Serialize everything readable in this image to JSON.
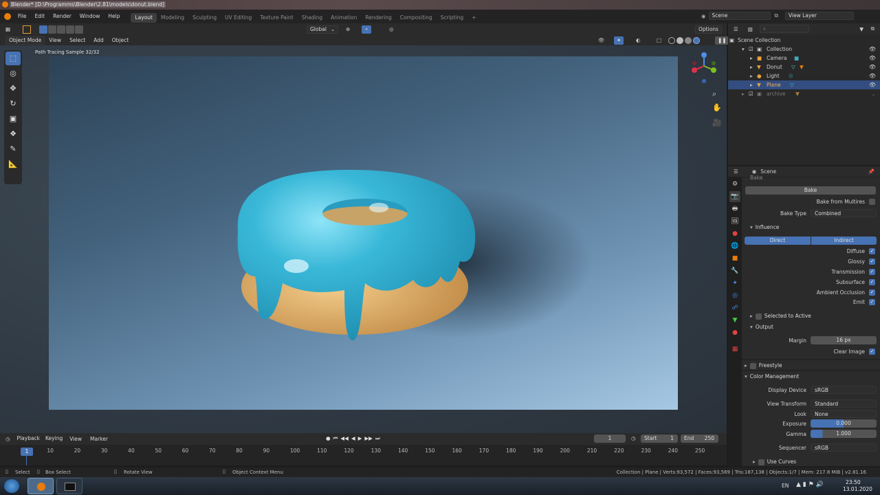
{
  "window": {
    "title": "Blender* [D:\\Programms\\Blender\\2.81\\models\\donut.blend]"
  },
  "menu": {
    "items": [
      "File",
      "Edit",
      "Render",
      "Window",
      "Help"
    ]
  },
  "workspaces": [
    "Layout",
    "Modeling",
    "Sculpting",
    "UV Editing",
    "Texture Paint",
    "Shading",
    "Animation",
    "Rendering",
    "Compositing",
    "Scripting"
  ],
  "active_workspace": "Layout",
  "scene_field": "Scene",
  "view_layer_field": "View Layer",
  "viewport_header": {
    "transform_orientation": "Global",
    "options_label": "Options",
    "mode": "Object Mode",
    "menus": [
      "View",
      "Select",
      "Add",
      "Object"
    ]
  },
  "viewport": {
    "info_text": "Path Tracing Sample 32/32"
  },
  "timeline": {
    "menus": [
      "Playback",
      "Keying",
      "View",
      "Marker"
    ],
    "current_frame": "1",
    "start_label": "Start",
    "start_value": "1",
    "end_label": "End",
    "end_value": "250",
    "frame_cursor": "1",
    "ticks": [
      "10",
      "20",
      "30",
      "40",
      "50",
      "60",
      "70",
      "80",
      "90",
      "100",
      "110",
      "120",
      "130",
      "140",
      "150",
      "160",
      "170",
      "180",
      "190",
      "200",
      "210",
      "220",
      "230",
      "240",
      "250"
    ]
  },
  "outliner": {
    "root": "Scene Collection",
    "rows": [
      {
        "label": "Collection",
        "selected": false
      },
      {
        "label": "Camera",
        "selected": false
      },
      {
        "label": "Donut",
        "selected": false
      },
      {
        "label": "Light",
        "selected": false
      },
      {
        "label": "Plane",
        "selected": true
      },
      {
        "label": "archive",
        "selected": false
      }
    ]
  },
  "properties": {
    "context": "Scene",
    "truncated_top": "Bake",
    "bake_button": "Bake",
    "bake_from_multires": "Bake from Multires",
    "bake_type_label": "Bake Type",
    "bake_type_value": "Combined",
    "influence_label": "Influence",
    "direct_label": "Direct",
    "indirect_label": "Indirect",
    "influence_checks": [
      "Diffuse",
      "Glossy",
      "Transmission",
      "Subsurface",
      "Ambient Occlusion",
      "Emit"
    ],
    "selected_to_active": "Selected to Active",
    "output_label": "Output",
    "margin_label": "Margin",
    "margin_value": "16 px",
    "clear_image": "Clear Image",
    "freestyle": "Freestyle",
    "color_management": "Color Management",
    "display_device_label": "Display Device",
    "display_device_value": "sRGB",
    "view_transform_label": "View Transform",
    "view_transform_value": "Standard",
    "look_label": "Look",
    "look_value": "None",
    "exposure_label": "Exposure",
    "exposure_value": "0.000",
    "gamma_label": "Gamma",
    "gamma_value": "1.000",
    "sequencer_label": "Sequencer",
    "sequencer_value": "sRGB",
    "use_curves": "Use Curves"
  },
  "statusbar": {
    "select": "Select",
    "box_select": "Box Select",
    "rotate_view": "Rotate View",
    "context_menu": "Object Context Menu",
    "stats": "Collection | Plane | Verts:93,572 | Faces:93,569 | Tris:187,138 | Objects:1/7 | Mem: 217.8 MiB | v2.81.16"
  },
  "taskbar": {
    "language": "EN",
    "time": "23:50",
    "date": "13.01.2020"
  },
  "colors": {
    "accent": "#4772b3",
    "blender_orange": "#e87d0d",
    "icing": "#3ab8d8",
    "dough": "#e8b870"
  }
}
